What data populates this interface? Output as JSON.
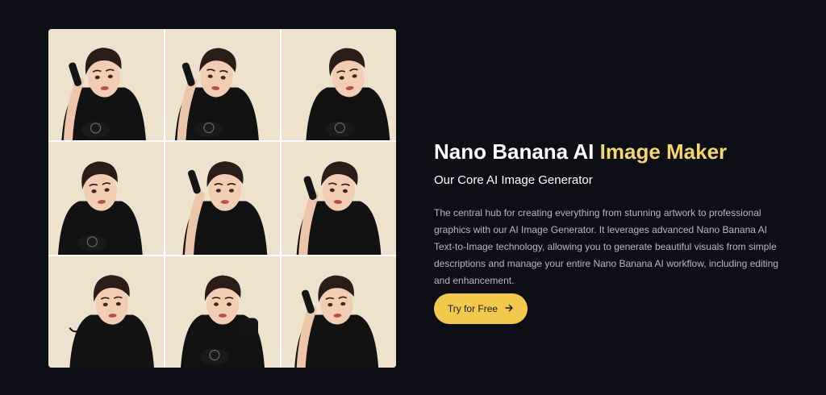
{
  "hero": {
    "title_part1": "Nano Banana AI",
    "title_part2": "Image Maker",
    "subtitle": "Our Core AI Image Generator",
    "description": "The central hub for creating everything from stunning artwork to professional graphics with our AI Image Generator. It leverages advanced Nano Banana AI Text-to-Image technology, allowing you to generate beautiful visuals from simple descriptions and manage your entire Nano Banana AI workflow, including editing and enhancement.",
    "cta_label": "Try for Free",
    "cta_icon": "arrow-right-icon"
  },
  "gallery": {
    "tiles": 9,
    "tile_icon": "portrait-with-telephone-image"
  },
  "colors": {
    "background": "#0e0e16",
    "accent_gold": "#f3d76a",
    "button": "#f2c94c",
    "tile_background": "#efe2cc"
  }
}
